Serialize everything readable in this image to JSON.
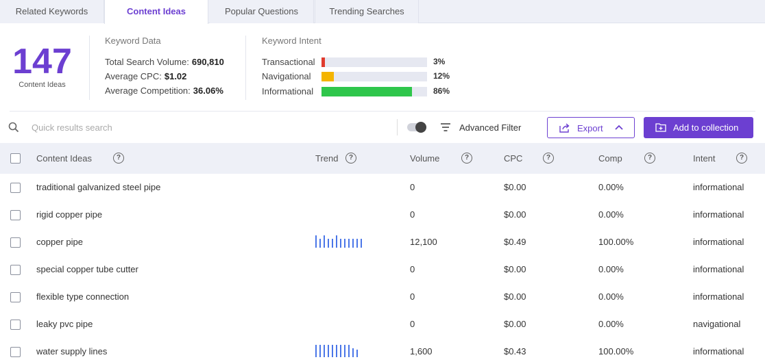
{
  "tabs": [
    "Related Keywords",
    "Content Ideas",
    "Popular Questions",
    "Trending Searches"
  ],
  "summary": {
    "count": "147",
    "count_caption": "Content Ideas",
    "keyword_data": {
      "title": "Keyword Data",
      "total_volume_label": "Total Search Volume:",
      "total_volume": "690,810",
      "avg_cpc_label": "Average CPC:",
      "avg_cpc": "$1.02",
      "avg_comp_label": "Average Competition:",
      "avg_comp": "36.06%"
    },
    "keyword_intent": {
      "title": "Keyword Intent",
      "items": [
        {
          "label": "Transactional",
          "pct_label": "3%",
          "value": 3,
          "color": "#e03b2e"
        },
        {
          "label": "Navigational",
          "pct_label": "12%",
          "value": 12,
          "color": "#f4b400"
        },
        {
          "label": "Informational",
          "pct_label": "86%",
          "value": 86,
          "color": "#2fc64b"
        }
      ]
    }
  },
  "toolbar": {
    "search_placeholder": "Quick results search",
    "filter_label": "Advanced Filter",
    "export_label": "Export",
    "collection_label": "Add to collection"
  },
  "table": {
    "headers": [
      "Content Ideas",
      "Trend",
      "Volume",
      "CPC",
      "Comp",
      "Intent"
    ],
    "rows": [
      {
        "idea": "traditional galvanized steel pipe",
        "trend": [],
        "volume": "0",
        "cpc": "$0.00",
        "comp": "0.00%",
        "intent": "informational"
      },
      {
        "idea": "rigid copper pipe",
        "trend": [],
        "volume": "0",
        "cpc": "$0.00",
        "comp": "0.00%",
        "intent": "informational"
      },
      {
        "idea": "copper pipe",
        "trend": [
          100,
          75,
          100,
          75,
          75,
          100,
          75,
          75,
          75,
          75,
          75,
          75
        ],
        "volume": "12,100",
        "cpc": "$0.49",
        "comp": "100.00%",
        "intent": "informational"
      },
      {
        "idea": "special copper tube cutter",
        "trend": [],
        "volume": "0",
        "cpc": "$0.00",
        "comp": "0.00%",
        "intent": "informational"
      },
      {
        "idea": "flexible type connection",
        "trend": [],
        "volume": "0",
        "cpc": "$0.00",
        "comp": "0.00%",
        "intent": "informational"
      },
      {
        "idea": "leaky pvc pipe",
        "trend": [],
        "volume": "0",
        "cpc": "$0.00",
        "comp": "0.00%",
        "intent": "navigational"
      },
      {
        "idea": "water supply lines",
        "trend": [
          100,
          100,
          100,
          100,
          100,
          100,
          100,
          100,
          100,
          75,
          60
        ],
        "volume": "1,600",
        "cpc": "$0.43",
        "comp": "100.00%",
        "intent": "informational"
      }
    ]
  },
  "colors": {
    "accent": "#6c3fd1",
    "trend_bar": "#4a76e8"
  }
}
